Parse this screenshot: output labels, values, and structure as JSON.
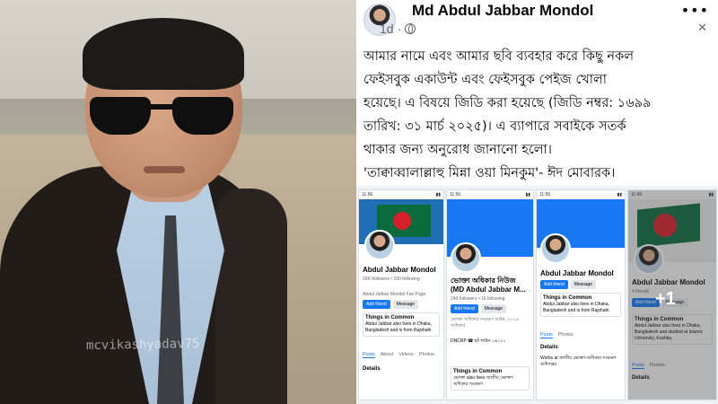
{
  "photo": {
    "watermark": "mcvikashyadav75"
  },
  "post": {
    "author": "Md Abdul Jabbar Mondol",
    "time": "1d",
    "more_icon": "•••",
    "close_icon": "✕",
    "text_lines": [
      "আমার নামে এবং আমার ছবি ব্যবহার করে কিছু নকল",
      "ফেইসবুক একাউন্ট এবং ফেইসবুক পেইজ খোলা",
      "হয়েছে। এ বিষয়ে জিডি করা হয়েছে (জিডি নম্বর: ১৬৯৯",
      "তারিখ: ৩১ মার্চ ২০২৫)। এ ব্যাপারে সবাইকে সতর্ক",
      "থাকার জন্য অনুরোধ জানানো হলো।",
      "'তাক্বাব্বালাল্লাহু মিন্না ওয়া মিনকুম'- ঈদ মোবারক।"
    ]
  },
  "shots": {
    "s1": {
      "status": "11:56",
      "name": "Abdul Jabbar Mondol",
      "followers": "16K followers • 100 following",
      "page": "Abdul Jabbar Mondol Fan Page",
      "add": "Add friend",
      "message": "Message",
      "card_title": "Things in Common",
      "card_text": "Abdul Jabbar also lives in Dhaka, Bangladesh and is from Rajshahi.",
      "tabs": [
        "Posts",
        "About",
        "Videos",
        "Photos"
      ],
      "details": "Details"
    },
    "s2": {
      "status": "11:56",
      "name": "ভোক্তা অধিকার নিউজ",
      "name2": "(MD Abdul Jabbar M...",
      "followers": "240 followers • 16 following",
      "sub": "ভোক্তা অধিকার সংরক্ষণ আইন, ২০০৯ অধিকার",
      "phone": "DNCRP ☎ হট লাইন ১৬১২১",
      "add": "Add friend",
      "message": "Message",
      "card_title": "Things in Common",
      "card_text": "ভোক্তা also lives জাতীয় ভোক্তা-অধিকার সংরক্ষণ"
    },
    "s3": {
      "status": "11:56",
      "name": "Abdul Jabbar Mondol",
      "add": "Add friend",
      "message": "Message",
      "card_title": "Things in Common",
      "card_text": "Abdul Jabbar also lives in Dhaka, Bangladesh and is from Rajshahi.",
      "tabs": [
        "Posts",
        "Photos"
      ],
      "details": "Details",
      "works": "Works at জাতীয় ভোক্তা-অধিকার সংরক্ষণ অধিদপ্তর"
    },
    "s4": {
      "status": "11:49",
      "name": "Abdul Jabbar Mondol",
      "friends": "4 friends",
      "add": "Add friend",
      "message": "Message",
      "card_title": "Things in Common",
      "card_text": "Abdul Jabbar also lives in Dhaka, Bangladesh and studied at Islamic University, Kushtia.",
      "tabs": [
        "Posts",
        "Photos"
      ],
      "details": "Details",
      "overlay": "+1"
    }
  }
}
